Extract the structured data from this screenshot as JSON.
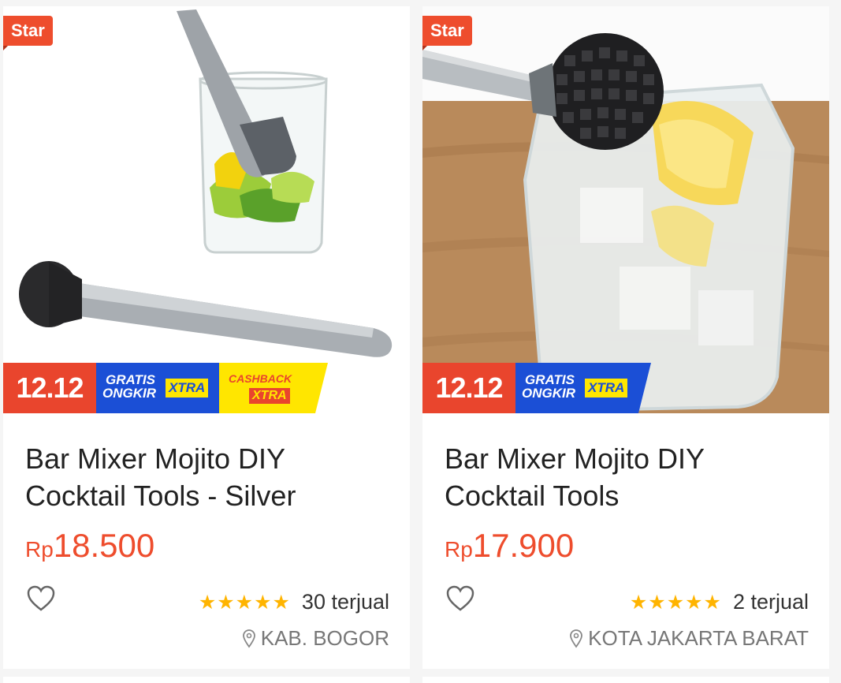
{
  "products": [
    {
      "badge": "Star",
      "promo": {
        "event": "12.12",
        "gratis_1": "GRATIS",
        "gratis_2": "ONGKIR",
        "xtra": "XTRA",
        "cashback_1": "CASHBACK",
        "cashback_2": "XTRA"
      },
      "title": "Bar Mixer Mojito DIY Cocktail Tools - Silver",
      "price_currency": "Rp",
      "price_amount": "18.500",
      "rating_stars": "★★★★★",
      "sold": "30 terjual",
      "location": "KAB. BOGOR"
    },
    {
      "badge": "Star",
      "promo": {
        "event": "12.12",
        "gratis_1": "GRATIS",
        "gratis_2": "ONGKIR",
        "xtra": "XTRA"
      },
      "title": "Bar Mixer Mojito DIY Cocktail Tools",
      "price_currency": "Rp",
      "price_amount": "17.900",
      "rating_stars": "★★★★★",
      "sold": "2 terjual",
      "location": "KOTA JAKARTA BARAT"
    }
  ],
  "colors": {
    "accent": "#ee4d2d",
    "star": "#ffb400",
    "gratis_blue": "#1b4fd6",
    "cashback_yellow": "#ffe600"
  },
  "icons": {
    "favorite": "heart-outline-icon",
    "location": "location-pin-icon",
    "rating": "star-icon"
  }
}
